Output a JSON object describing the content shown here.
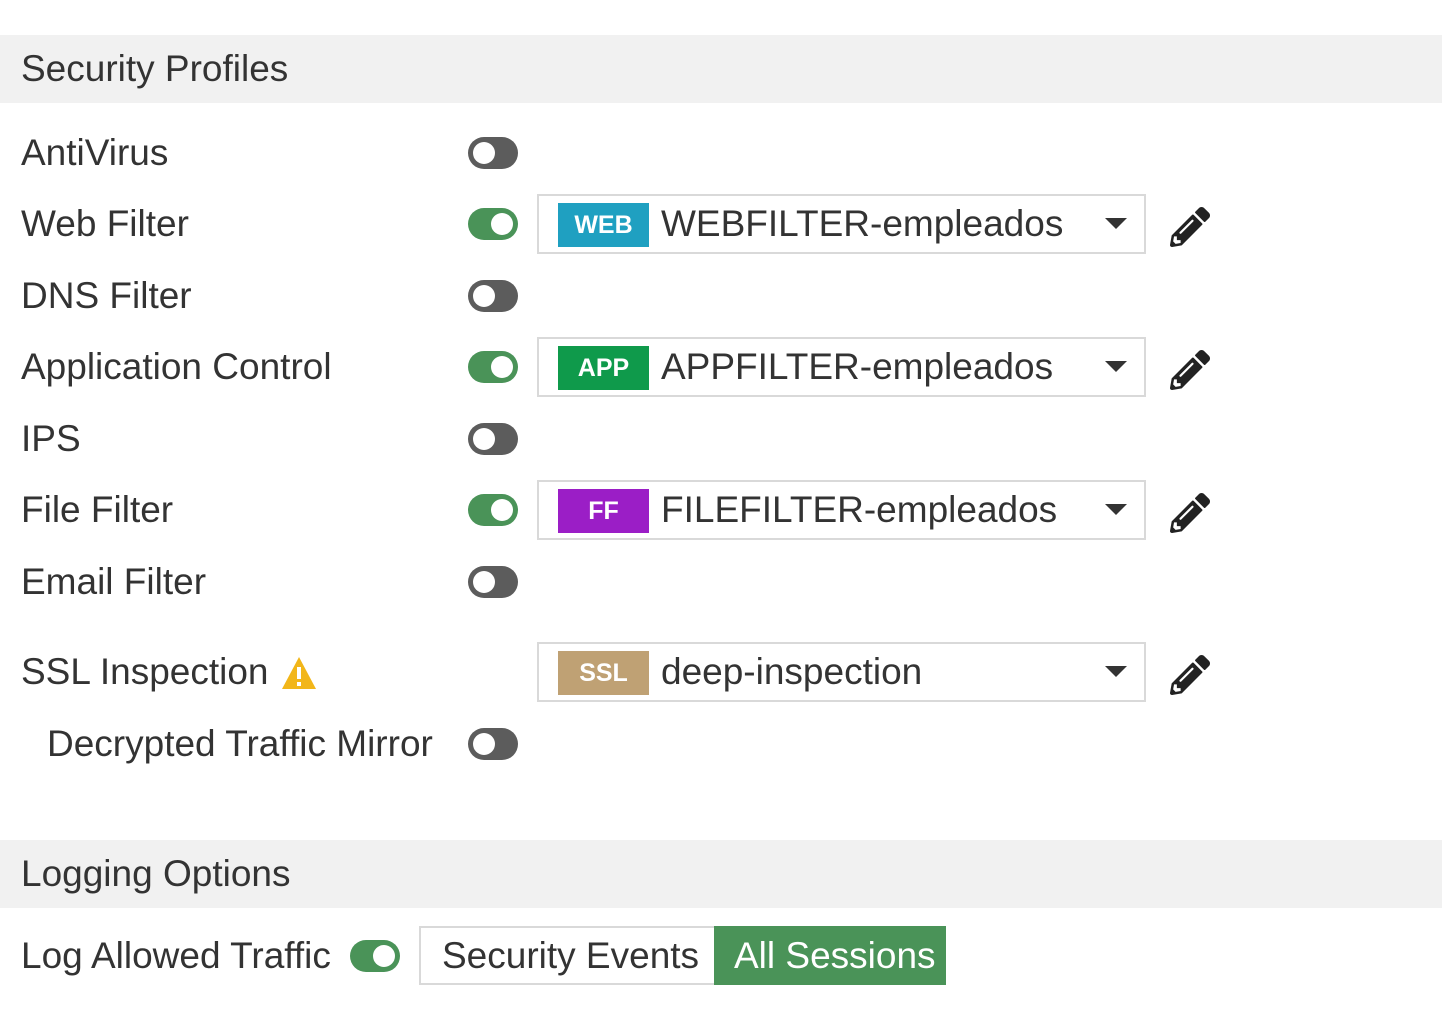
{
  "security_profiles": {
    "title": "Security Profiles",
    "rows": [
      {
        "label": "AntiVirus",
        "enabled": false
      },
      {
        "label": "Web Filter",
        "enabled": true,
        "badge": "WEB",
        "badge_color": "#1fa0c1",
        "profile": "WEBFILTER-empleados",
        "edit_icon": "pencil-icon"
      },
      {
        "label": "DNS Filter",
        "enabled": false
      },
      {
        "label": "Application Control",
        "enabled": true,
        "badge": "APP",
        "badge_color": "#0f9a4b",
        "profile": "APPFILTER-empleados",
        "edit_icon": "pencil-icon"
      },
      {
        "label": "IPS",
        "enabled": false
      },
      {
        "label": "File Filter",
        "enabled": true,
        "badge": "FF",
        "badge_color": "#9b1ec6",
        "profile": "FILEFILTER-empleados",
        "edit_icon": "pencil-icon"
      },
      {
        "label": "Email Filter",
        "enabled": false
      }
    ],
    "ssl": {
      "label": "SSL Inspection",
      "warning_icon": "warning-icon",
      "badge": "SSL",
      "badge_color": "#bfa174",
      "profile": "deep-inspection",
      "edit_icon": "pencil-icon"
    },
    "decrypted_mirror": {
      "label": "Decrypted Traffic Mirror",
      "enabled": false
    }
  },
  "logging_options": {
    "title": "Logging Options",
    "log_allowed": {
      "label": "Log Allowed Traffic",
      "enabled": true
    },
    "modes": [
      "Security Events",
      "All Sessions"
    ],
    "selected_mode": "All Sessions"
  },
  "colors": {
    "toggle_on": "#4a9358",
    "toggle_off": "#5c5c5c",
    "header_bg": "#f1f1f1",
    "selected_segment": "#4a9358",
    "warning": "#f2b619"
  }
}
